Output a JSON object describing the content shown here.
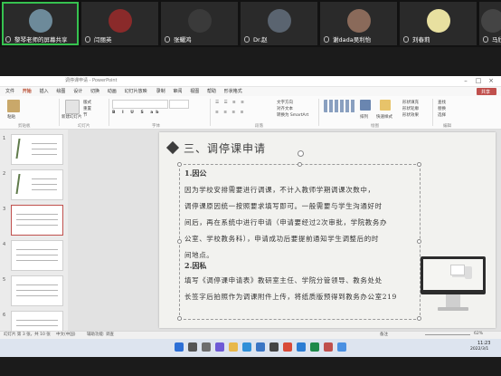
{
  "participants": [
    {
      "name": "黎琴老师的屏幕共享",
      "active": true,
      "color": "#6d8a9a"
    },
    {
      "name": "闫丽英",
      "active": false,
      "color": "#8a2a2a"
    },
    {
      "name": "张耀鸿",
      "active": false,
      "color": "#3a3a3a"
    },
    {
      "name": "Dr.赵",
      "active": false,
      "color": "#5a6470"
    },
    {
      "name": "谢dada吴利怡",
      "active": false,
      "color": "#8a6a5a"
    },
    {
      "name": "刘春莉",
      "active": false,
      "color": "#e8e0a0"
    },
    {
      "name": "马欣",
      "active": false,
      "color": "#444"
    }
  ],
  "window": {
    "title": "调停课申请 - PowerPoint",
    "menus": [
      "文件",
      "开始",
      "插入",
      "绘图",
      "设计",
      "切换",
      "动画",
      "幻灯片放映",
      "录制",
      "审阅",
      "视图",
      "帮助",
      "形状格式"
    ],
    "selected_menu": "开始",
    "share_label": "共享"
  },
  "ribbon": {
    "groups": [
      "剪贴板",
      "幻灯片",
      "字体",
      "段落",
      "绘图",
      "编辑"
    ],
    "items": {
      "paste": "粘贴",
      "new_slide": "新建幻灯片",
      "reuse": "重用幻灯片",
      "layout": "版式",
      "reset": "重置",
      "section": "节",
      "text_direction": "文字方向",
      "align_text": "对齐文本",
      "smartart": "转换为 SmartArt",
      "arrange": "排列",
      "quick_styles": "快速样式",
      "shape_fill": "形状填充",
      "shape_outline": "形状轮廓",
      "shape_effects": "形状效果",
      "find": "查找",
      "replace": "替换",
      "select": "选择"
    }
  },
  "thumbnails": [
    "1",
    "2",
    "3",
    "4",
    "5",
    "6"
  ],
  "selected_thumbnail": "3",
  "slide": {
    "heading": "三、调停课申请",
    "section1_title": "1.因公",
    "section1_lines": [
      "因为学校安排需要进行调课，不计入教师学期调课次数中，",
      "调停课原因统一按照要求填写即可。一般需要与学生沟通好时",
      "间后，再在系统中进行申请（申请要经过2次审批，学院教务办",
      "公室、学校教务科），申请成功后要提前通知学生调整后的时",
      "间地点。"
    ],
    "section2_title": "2.因私",
    "section2_lines": [
      "填写《调停课申请表》教研室主任、学院分管领导、教务处处",
      "长签字后拍照作为调课附件上传，将纸质版预得到教务办公室219"
    ]
  },
  "status": {
    "slide_info": "幻灯片 第 3 张，共 10 张",
    "language": "中文(中国)",
    "accessibility": "辅助功能: 调查",
    "notes": "备注",
    "zoom": "62%"
  },
  "taskbar": {
    "time": "11:23",
    "date": "2022/3/1"
  }
}
